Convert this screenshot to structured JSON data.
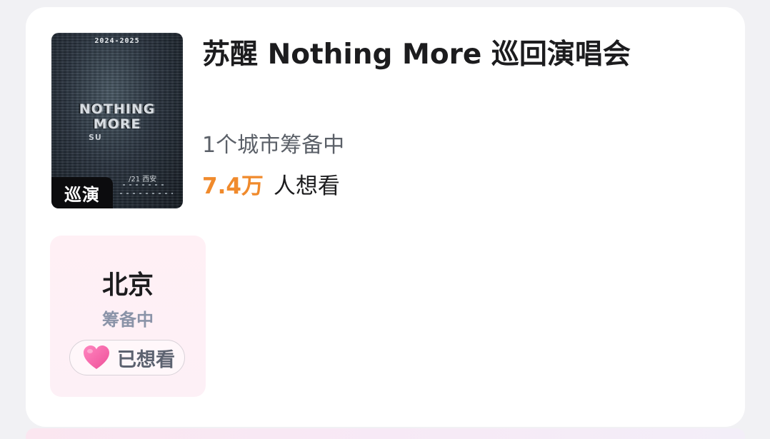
{
  "poster": {
    "years": "2024-2025",
    "line_one": "NOTHING",
    "line_two": "MORE",
    "artist": "SU",
    "date": "/21 西安",
    "tag": "巡演"
  },
  "event": {
    "title": "苏醒 Nothing More 巡回演唱会",
    "city_count_text": "1个城市筹备中",
    "want_count": "7.4万",
    "want_suffix": "人想看"
  },
  "city_card": {
    "name": "北京",
    "status": "筹备中",
    "want_button_label": "已想看"
  },
  "colors": {
    "accent_orange": "#f08a2c",
    "heart_pink": "#f26aa8",
    "card_pink": "#fff0f5"
  },
  "icons": {
    "heart": "heart-icon"
  }
}
